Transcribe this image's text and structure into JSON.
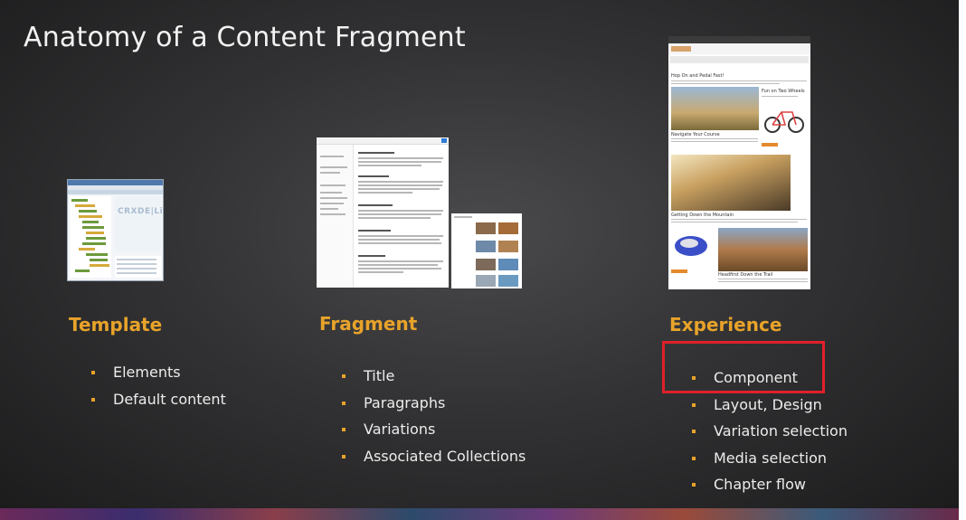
{
  "slide": {
    "title": "Anatomy of a Content Fragment",
    "accent_color": "#e8a32a",
    "highlight_color": "#e0202a",
    "columns": [
      {
        "heading": "Template",
        "items": [
          "Elements",
          "Default content"
        ]
      },
      {
        "heading": "Fragment",
        "items": [
          "Title",
          "Paragraphs",
          "Variations",
          "Associated Collections"
        ]
      },
      {
        "heading": "Experience",
        "items": [
          "Component",
          "Layout, Design",
          "Variation selection",
          "Media selection",
          "Chapter flow"
        ]
      }
    ],
    "highlighted_item": "Component"
  },
  "thumbnails": {
    "template": {
      "logo": "CRXDE|Li"
    },
    "experience": {
      "headlines": [
        "Hop On and Pedal Fast!",
        "Fun on Two Wheels",
        "Navigate Your Course",
        "Getting Down the Mountain",
        "Headfirst Down the Trail"
      ]
    }
  }
}
